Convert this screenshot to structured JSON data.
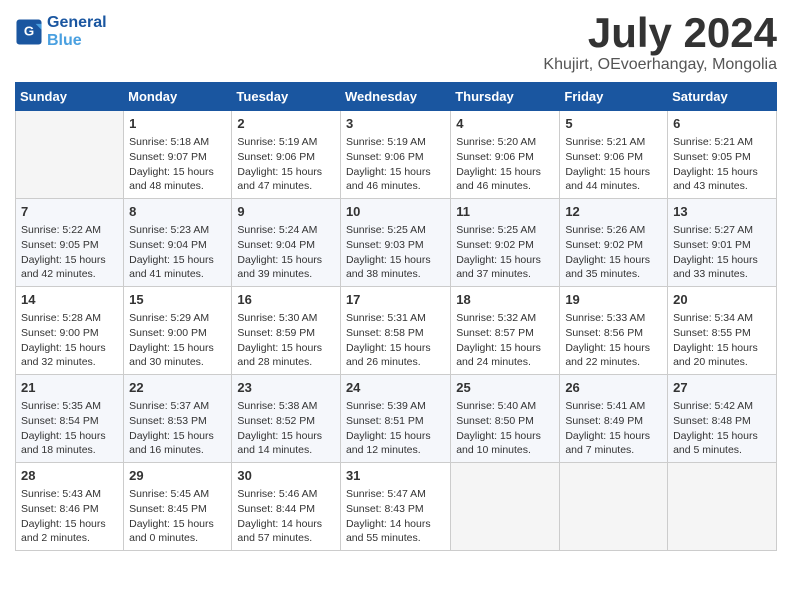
{
  "logo": {
    "line1": "General",
    "line2": "Blue"
  },
  "title": "July 2024",
  "subtitle": "Khujirt, OEvoerhangay, Mongolia",
  "weekdays": [
    "Sunday",
    "Monday",
    "Tuesday",
    "Wednesday",
    "Thursday",
    "Friday",
    "Saturday"
  ],
  "weeks": [
    [
      {
        "day": "",
        "info": ""
      },
      {
        "day": "1",
        "info": "Sunrise: 5:18 AM\nSunset: 9:07 PM\nDaylight: 15 hours\nand 48 minutes."
      },
      {
        "day": "2",
        "info": "Sunrise: 5:19 AM\nSunset: 9:06 PM\nDaylight: 15 hours\nand 47 minutes."
      },
      {
        "day": "3",
        "info": "Sunrise: 5:19 AM\nSunset: 9:06 PM\nDaylight: 15 hours\nand 46 minutes."
      },
      {
        "day": "4",
        "info": "Sunrise: 5:20 AM\nSunset: 9:06 PM\nDaylight: 15 hours\nand 46 minutes."
      },
      {
        "day": "5",
        "info": "Sunrise: 5:21 AM\nSunset: 9:06 PM\nDaylight: 15 hours\nand 44 minutes."
      },
      {
        "day": "6",
        "info": "Sunrise: 5:21 AM\nSunset: 9:05 PM\nDaylight: 15 hours\nand 43 minutes."
      }
    ],
    [
      {
        "day": "7",
        "info": "Sunrise: 5:22 AM\nSunset: 9:05 PM\nDaylight: 15 hours\nand 42 minutes."
      },
      {
        "day": "8",
        "info": "Sunrise: 5:23 AM\nSunset: 9:04 PM\nDaylight: 15 hours\nand 41 minutes."
      },
      {
        "day": "9",
        "info": "Sunrise: 5:24 AM\nSunset: 9:04 PM\nDaylight: 15 hours\nand 39 minutes."
      },
      {
        "day": "10",
        "info": "Sunrise: 5:25 AM\nSunset: 9:03 PM\nDaylight: 15 hours\nand 38 minutes."
      },
      {
        "day": "11",
        "info": "Sunrise: 5:25 AM\nSunset: 9:02 PM\nDaylight: 15 hours\nand 37 minutes."
      },
      {
        "day": "12",
        "info": "Sunrise: 5:26 AM\nSunset: 9:02 PM\nDaylight: 15 hours\nand 35 minutes."
      },
      {
        "day": "13",
        "info": "Sunrise: 5:27 AM\nSunset: 9:01 PM\nDaylight: 15 hours\nand 33 minutes."
      }
    ],
    [
      {
        "day": "14",
        "info": "Sunrise: 5:28 AM\nSunset: 9:00 PM\nDaylight: 15 hours\nand 32 minutes."
      },
      {
        "day": "15",
        "info": "Sunrise: 5:29 AM\nSunset: 9:00 PM\nDaylight: 15 hours\nand 30 minutes."
      },
      {
        "day": "16",
        "info": "Sunrise: 5:30 AM\nSunset: 8:59 PM\nDaylight: 15 hours\nand 28 minutes."
      },
      {
        "day": "17",
        "info": "Sunrise: 5:31 AM\nSunset: 8:58 PM\nDaylight: 15 hours\nand 26 minutes."
      },
      {
        "day": "18",
        "info": "Sunrise: 5:32 AM\nSunset: 8:57 PM\nDaylight: 15 hours\nand 24 minutes."
      },
      {
        "day": "19",
        "info": "Sunrise: 5:33 AM\nSunset: 8:56 PM\nDaylight: 15 hours\nand 22 minutes."
      },
      {
        "day": "20",
        "info": "Sunrise: 5:34 AM\nSunset: 8:55 PM\nDaylight: 15 hours\nand 20 minutes."
      }
    ],
    [
      {
        "day": "21",
        "info": "Sunrise: 5:35 AM\nSunset: 8:54 PM\nDaylight: 15 hours\nand 18 minutes."
      },
      {
        "day": "22",
        "info": "Sunrise: 5:37 AM\nSunset: 8:53 PM\nDaylight: 15 hours\nand 16 minutes."
      },
      {
        "day": "23",
        "info": "Sunrise: 5:38 AM\nSunset: 8:52 PM\nDaylight: 15 hours\nand 14 minutes."
      },
      {
        "day": "24",
        "info": "Sunrise: 5:39 AM\nSunset: 8:51 PM\nDaylight: 15 hours\nand 12 minutes."
      },
      {
        "day": "25",
        "info": "Sunrise: 5:40 AM\nSunset: 8:50 PM\nDaylight: 15 hours\nand 10 minutes."
      },
      {
        "day": "26",
        "info": "Sunrise: 5:41 AM\nSunset: 8:49 PM\nDaylight: 15 hours\nand 7 minutes."
      },
      {
        "day": "27",
        "info": "Sunrise: 5:42 AM\nSunset: 8:48 PM\nDaylight: 15 hours\nand 5 minutes."
      }
    ],
    [
      {
        "day": "28",
        "info": "Sunrise: 5:43 AM\nSunset: 8:46 PM\nDaylight: 15 hours\nand 2 minutes."
      },
      {
        "day": "29",
        "info": "Sunrise: 5:45 AM\nSunset: 8:45 PM\nDaylight: 15 hours\nand 0 minutes."
      },
      {
        "day": "30",
        "info": "Sunrise: 5:46 AM\nSunset: 8:44 PM\nDaylight: 14 hours\nand 57 minutes."
      },
      {
        "day": "31",
        "info": "Sunrise: 5:47 AM\nSunset: 8:43 PM\nDaylight: 14 hours\nand 55 minutes."
      },
      {
        "day": "",
        "info": ""
      },
      {
        "day": "",
        "info": ""
      },
      {
        "day": "",
        "info": ""
      }
    ]
  ]
}
